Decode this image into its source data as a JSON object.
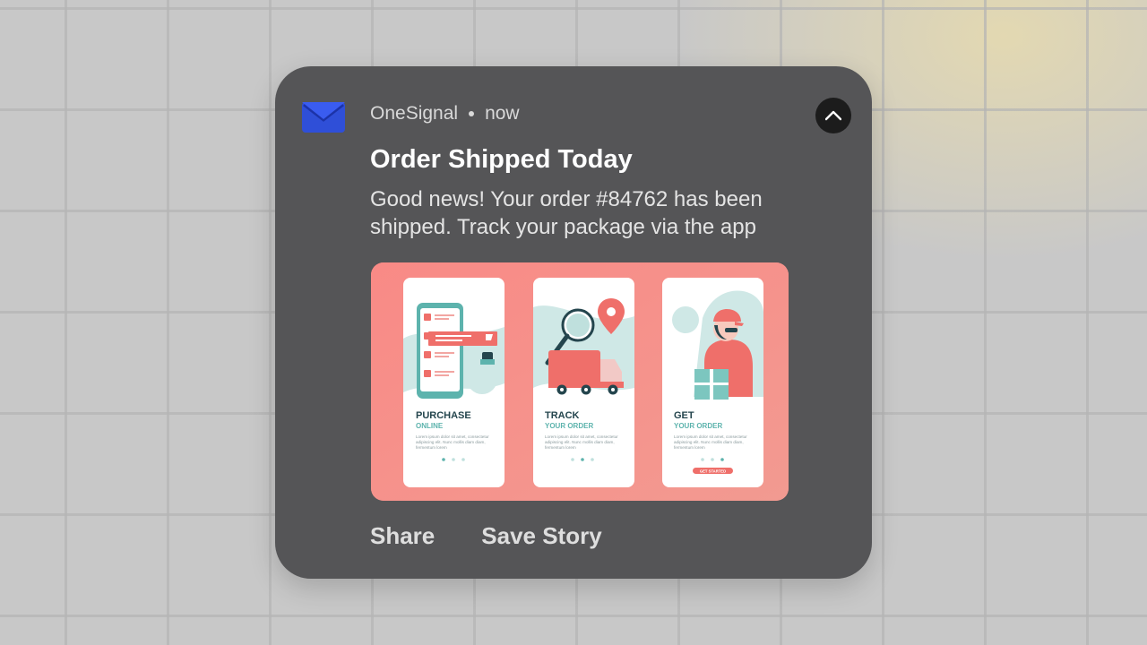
{
  "notification": {
    "app_name": "OneSignal",
    "time": "now",
    "title": "Order Shipped Today",
    "body": "Good news! Your order #84762 has been shipped. Track your package via the app",
    "app_icon": "mail-envelope-icon",
    "collapse_icon": "chevron-up-icon",
    "actions": [
      {
        "label": "Share"
      },
      {
        "label": "Save Story"
      }
    ],
    "image": {
      "screens": [
        {
          "title": "PURCHASE",
          "subtitle": "ONLINE",
          "text1": "Lorem ipsum dolor sit amet, consectetur",
          "text2": "adipiscing elit. Nunc mollis diam diam,",
          "text3": "fermentum lorem",
          "active_dot": 0,
          "button": ""
        },
        {
          "title": "TRACK",
          "subtitle": "YOUR ORDER",
          "text1": "Lorem ipsum dolor sit amet, consectetur",
          "text2": "adipiscing elit. Nunc mollis diam diam,",
          "text3": "fermentum lorem",
          "active_dot": 1,
          "button": ""
        },
        {
          "title": "GET",
          "subtitle": "YOUR ORDER",
          "text1": "Lorem ipsum dolor sit amet, consectetur",
          "text2": "adipiscing elit. Nunc mollis diam diam,",
          "text3": "fermentum lorem",
          "active_dot": 2,
          "button": "GET STARTED"
        }
      ]
    }
  },
  "colors": {
    "card": "#555557",
    "image_bg": "#f48c86",
    "teal": "#5db3ad",
    "dark_teal": "#24454d",
    "coral": "#ef6f6a"
  }
}
